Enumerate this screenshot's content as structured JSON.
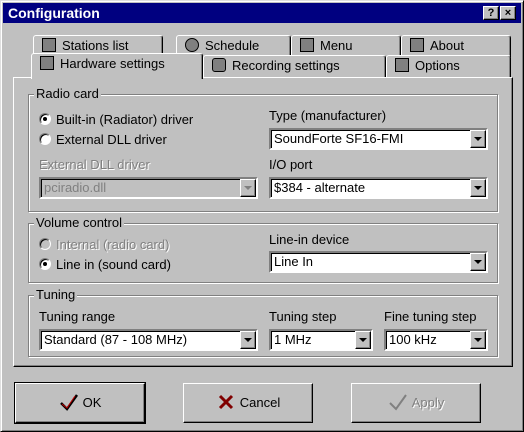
{
  "window": {
    "title": "Configuration",
    "help_label": "?",
    "close_label": "×"
  },
  "tabs": {
    "row1": [
      {
        "label": "Stations list",
        "icon": "stations-list-icon"
      },
      {
        "label": "Schedule",
        "icon": "clock-icon"
      },
      {
        "label": "Menu",
        "icon": "menu-icon"
      },
      {
        "label": "About",
        "icon": "about-icon"
      }
    ],
    "row2": [
      {
        "label": "Hardware settings",
        "icon": "hardware-icon",
        "active": true
      },
      {
        "label": "Recording settings",
        "icon": "record-icon"
      },
      {
        "label": "Options",
        "icon": "options-icon"
      }
    ]
  },
  "radio_card": {
    "title": "Radio card",
    "builtin_label": "Built-in (Radiator) driver",
    "external_label": "External DLL driver",
    "selected": "builtin",
    "dll_label": "External DLL driver",
    "dll_value": "pciradio.dll",
    "type_label": "Type (manufacturer)",
    "type_value": "SoundForte SF16-FMI",
    "io_label": "I/O port",
    "io_value": "$384 - alternate"
  },
  "volume": {
    "title": "Volume control",
    "internal_label": "Internal (radio card)",
    "linein_label": "Line in (sound card)",
    "selected": "linein",
    "device_label": "Line-in device",
    "device_value": "Line In"
  },
  "tuning": {
    "title": "Tuning",
    "range_label": "Tuning range",
    "range_value": "Standard (87 - 108 MHz)",
    "step_label": "Tuning step",
    "step_value": "1 MHz",
    "fine_label": "Fine tuning step",
    "fine_value": "100 kHz"
  },
  "buttons": {
    "ok_label": "OK",
    "cancel_label": "Cancel",
    "apply_label": "Apply"
  },
  "colors": {
    "title_bg": "#000080",
    "face": "#c0c0c0"
  }
}
